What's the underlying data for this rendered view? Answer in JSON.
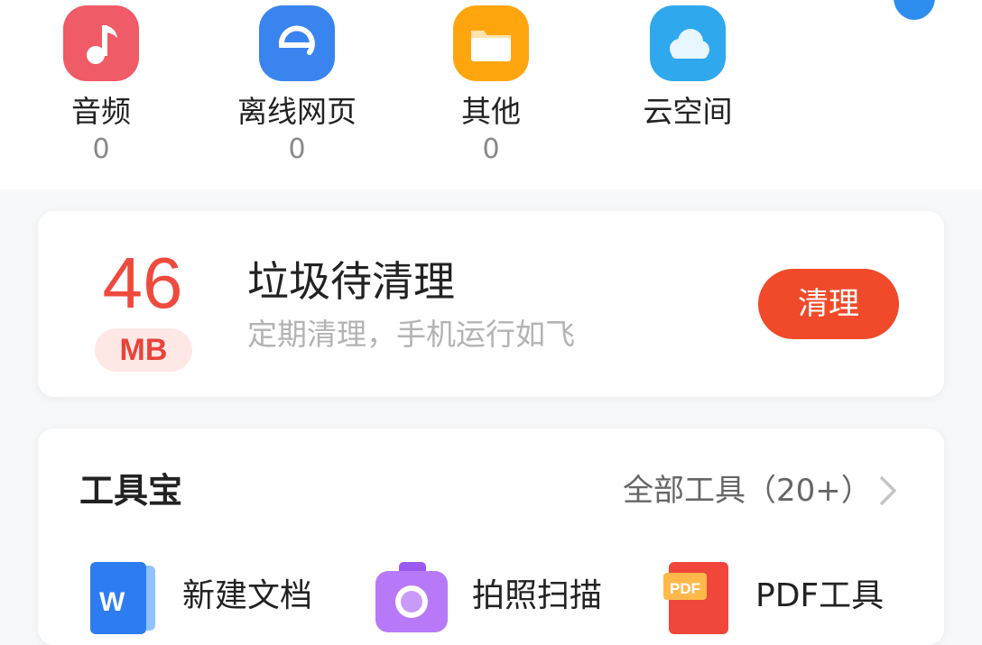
{
  "categories": [
    {
      "label": "音频",
      "count": "0",
      "icon": "music-note-icon",
      "color": "#ef5b66"
    },
    {
      "label": "离线网页",
      "count": "0",
      "icon": "browser-e-icon",
      "color": "#3a84ef"
    },
    {
      "label": "其他",
      "count": "0",
      "icon": "folder-icon",
      "color": "#ffa60f"
    },
    {
      "label": "云空间",
      "count": "",
      "icon": "cloud-icon",
      "color": "#2fa8ee"
    }
  ],
  "cleaner": {
    "amount": "46",
    "unit": "MB",
    "title": "垃圾待清理",
    "subtitle": "定期清理，手机运行如飞",
    "button_label": "清理",
    "accent": "#f04a2a"
  },
  "toolbox": {
    "title": "工具宝",
    "all_tools_label": "全部工具（20+）",
    "tools": [
      {
        "label": "新建文档",
        "icon": "word-document-icon"
      },
      {
        "label": "拍照扫描",
        "icon": "camera-scan-icon"
      },
      {
        "label": "PDF工具",
        "icon": "pdf-icon",
        "icon_text": "PDF"
      }
    ]
  }
}
